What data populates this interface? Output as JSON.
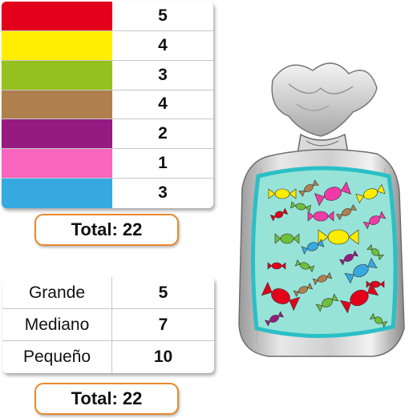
{
  "color_table": {
    "rows": [
      {
        "color": "#e3001b",
        "count": "5"
      },
      {
        "color": "#ffed00",
        "count": "4"
      },
      {
        "color": "#95c11f",
        "count": "3"
      },
      {
        "color": "#b07f4e",
        "count": "4"
      },
      {
        "color": "#951b81",
        "count": "2"
      },
      {
        "color": "#f866c0",
        "count": "1"
      },
      {
        "color": "#36a9e1",
        "count": "3"
      }
    ],
    "total": "Total: 22"
  },
  "size_table": {
    "rows": [
      {
        "label": "Grande",
        "count": "5"
      },
      {
        "label": "Mediano",
        "count": "7"
      },
      {
        "label": "Pequeño",
        "count": "10"
      }
    ],
    "total": "Total: 22"
  },
  "colors": {
    "total_border": "#ea8a2e",
    "bag_label": "#98e3d8",
    "bag_label_border": "#2bbfc6"
  }
}
